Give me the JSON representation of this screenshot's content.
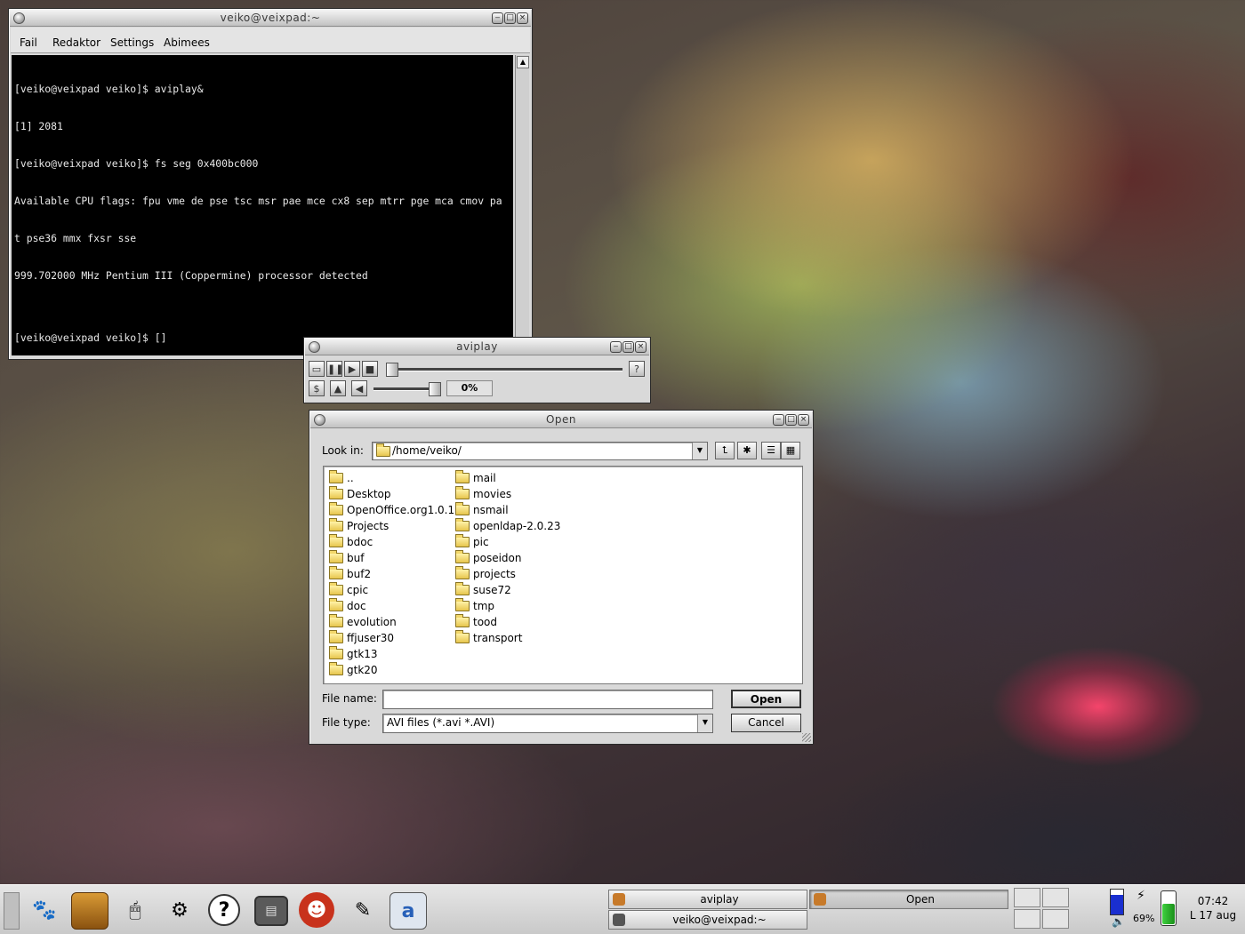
{
  "terminal": {
    "title": "veiko@veixpad:~",
    "menu": [
      "Fail",
      "Redaktor",
      "Settings",
      "Abimees"
    ],
    "lines": [
      "[veiko@veixpad veiko]$ aviplay&",
      "[1] 2081",
      "[veiko@veixpad veiko]$ fs seg 0x400bc000",
      "Available CPU flags: fpu vme de pse tsc msr pae mce cx8 sep mtrr pge mca cmov pa",
      "t pse36 mmx fxsr sse",
      "999.702000 MHz Pentium III (Coppermine) processor detected",
      "",
      "[veiko@veixpad veiko]$ []"
    ]
  },
  "aviplay": {
    "title": "aviplay",
    "progress_label": "0%",
    "progress_fraction": 0
  },
  "open_dialog": {
    "title": "Open",
    "look_in_label": "Look in:",
    "look_in_value": "/home/veiko/",
    "file_name_label": "File name:",
    "file_name_value": "",
    "file_type_label": "File type:",
    "file_type_value": "AVI files (*.avi *.AVI)",
    "open_button": "Open",
    "cancel_button": "Cancel",
    "folders_col1": [
      "..",
      "Desktop",
      "OpenOffice.org1.0.1",
      "Projects",
      "bdoc",
      "buf",
      "buf2",
      "cpic",
      "doc",
      "evolution",
      "ffjuser30",
      "gtk13",
      "gtk20"
    ],
    "folders_col2": [
      "mail",
      "movies",
      "nsmail",
      "openldap-2.0.23",
      "pic",
      "poseidon",
      "projects",
      "suse72",
      "tmp",
      "tood",
      "transport"
    ]
  },
  "taskbar": {
    "tasks": [
      "aviplay",
      "Open",
      "veiko@veixpad:~"
    ],
    "battery_percent": "69%",
    "battery_level": 0.69,
    "clock_time": "07:42",
    "clock_date": "L 17 aug",
    "launcher_icons": [
      "gnome-foot-icon",
      "file-manager-icon",
      "mouse-icon",
      "control-center-icon",
      "help-icon",
      "terminal-icon",
      "mozilla-icon",
      "text-editor-icon",
      "window-icon"
    ]
  },
  "colors": {
    "terminal_bg": "#000000",
    "terminal_fg": "#e8e8e8",
    "window_bg": "#d9d9d9",
    "folder_yellow": "#e7c64e"
  }
}
